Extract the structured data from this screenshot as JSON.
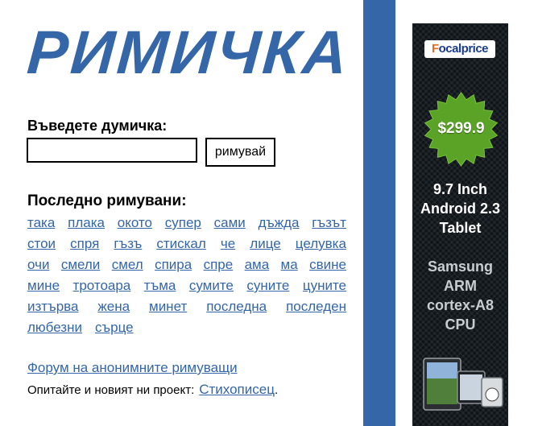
{
  "logo": "РИМИЧКА",
  "prompt_label": "Въведете думичка:",
  "search": {
    "value": "",
    "placeholder": ""
  },
  "rhyme_button": "римувай",
  "recent_title": "Последно римувани:",
  "recent_words": [
    [
      "така",
      "плака",
      "окото",
      "супер",
      "сами",
      "дъжда",
      "гъзът"
    ],
    [
      "стои",
      "спря",
      "гъзъ",
      "стискал",
      "че",
      "лице",
      "целувка"
    ],
    [
      "очи",
      "смели",
      "смел",
      "спира",
      "спре",
      "ама",
      "ма",
      "свине"
    ],
    [
      "мине",
      "тротоара",
      "тъма",
      "сумите",
      "суните",
      "цуните"
    ],
    [
      "изтърва",
      "жена",
      "минет",
      "последна",
      "последен"
    ],
    [
      "любезни",
      "сърце"
    ]
  ],
  "forum_link": "Форум на анонимните римуващи",
  "project": {
    "text": "Опитайте и новият ни проект:",
    "link": "Стихописец",
    "suffix": "."
  },
  "ad": {
    "brand_f": "F",
    "brand_rest": "ocalprice",
    "price": "$299.9",
    "title_lines": [
      "9.7 Inch",
      "Android 2.3",
      "Tablet"
    ],
    "spec_lines": [
      "Samsung",
      "ARM",
      "cortex-A8",
      "CPU"
    ],
    "colors": {
      "starburst": "#5aa326",
      "background": "#0f1418"
    }
  },
  "colors": {
    "link": "#3466a8",
    "bar": "#3466a8"
  }
}
